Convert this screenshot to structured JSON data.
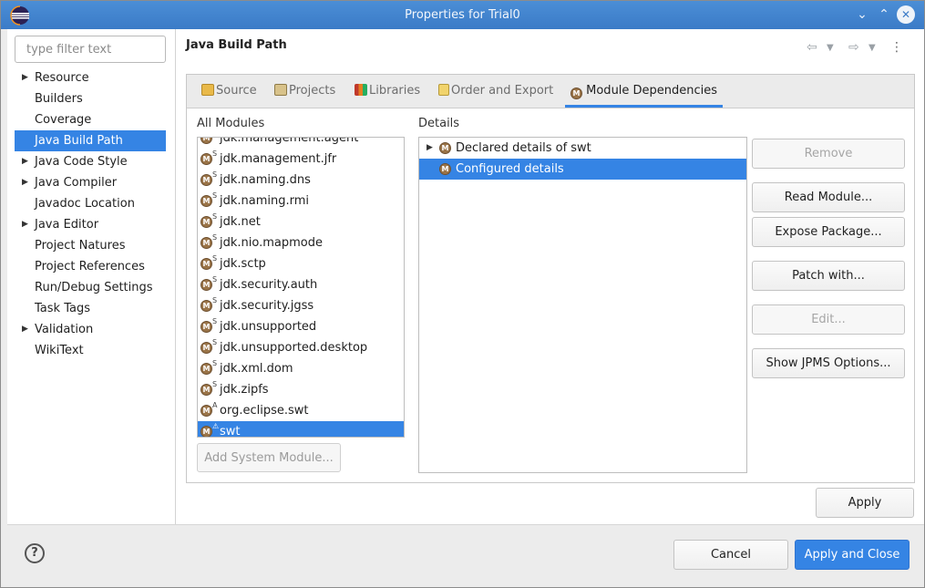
{
  "window": {
    "title": "Properties for Trial0",
    "icons": {
      "logo": "eclipse-logo-icon",
      "minimize": "chevron-down-icon",
      "maximize": "chevron-up-icon",
      "close": "close-icon"
    }
  },
  "filter": {
    "placeholder": "type filter text"
  },
  "nav": {
    "items": [
      {
        "label": "Resource",
        "expandable": true
      },
      {
        "label": "Builders",
        "expandable": false
      },
      {
        "label": "Coverage",
        "expandable": false
      },
      {
        "label": "Java Build Path",
        "expandable": false,
        "selected": true
      },
      {
        "label": "Java Code Style",
        "expandable": true
      },
      {
        "label": "Java Compiler",
        "expandable": true
      },
      {
        "label": "Javadoc Location",
        "expandable": false
      },
      {
        "label": "Java Editor",
        "expandable": true
      },
      {
        "label": "Project Natures",
        "expandable": false
      },
      {
        "label": "Project References",
        "expandable": false
      },
      {
        "label": "Run/Debug Settings",
        "expandable": false
      },
      {
        "label": "Task Tags",
        "expandable": false
      },
      {
        "label": "Validation",
        "expandable": true
      },
      {
        "label": "WikiText",
        "expandable": false
      }
    ]
  },
  "page": {
    "title": "Java Build Path"
  },
  "tabs": [
    {
      "label": "Source",
      "icon": "source-folder-icon"
    },
    {
      "label": "Projects",
      "icon": "projects-icon"
    },
    {
      "label": "Libraries",
      "icon": "libraries-icon"
    },
    {
      "label": "Order and Export",
      "icon": "order-export-icon"
    },
    {
      "label": "Module Dependencies",
      "icon": "module-icon",
      "active": true
    }
  ],
  "modules": {
    "label": "All Modules",
    "partial_top": "jdk.management.agent",
    "items": [
      {
        "name": "jdk.management.jfr",
        "badge": "S"
      },
      {
        "name": "jdk.naming.dns",
        "badge": "S"
      },
      {
        "name": "jdk.naming.rmi",
        "badge": "S"
      },
      {
        "name": "jdk.net",
        "badge": "S"
      },
      {
        "name": "jdk.nio.mapmode",
        "badge": "S"
      },
      {
        "name": "jdk.sctp",
        "badge": "S"
      },
      {
        "name": "jdk.security.auth",
        "badge": "S"
      },
      {
        "name": "jdk.security.jgss",
        "badge": "S"
      },
      {
        "name": "jdk.unsupported",
        "badge": "S"
      },
      {
        "name": "jdk.unsupported.desktop",
        "badge": "S"
      },
      {
        "name": "jdk.xml.dom",
        "badge": "S"
      },
      {
        "name": "jdk.zipfs",
        "badge": "S"
      },
      {
        "name": "org.eclipse.swt",
        "badge": "A"
      },
      {
        "name": "swt",
        "badge": "⚠",
        "selected": true
      }
    ],
    "add_button": "Add System Module..."
  },
  "details": {
    "label": "Details",
    "items": [
      {
        "label": "Declared details of swt",
        "expandable": true
      },
      {
        "label": "Configured details",
        "expandable": false,
        "selected": true
      }
    ]
  },
  "buttons": {
    "remove": "Remove",
    "read_module": "Read Module...",
    "expose_package": "Expose Package...",
    "patch_with": "Patch with...",
    "edit": "Edit...",
    "show_jpms": "Show JPMS Options...",
    "apply": "Apply",
    "cancel": "Cancel",
    "apply_close": "Apply and Close"
  },
  "footer": {
    "help_icon": "?"
  },
  "colors": {
    "accent": "#3584e4",
    "titlebar": "#3b7bc7",
    "module_icon": "#9a7448"
  }
}
